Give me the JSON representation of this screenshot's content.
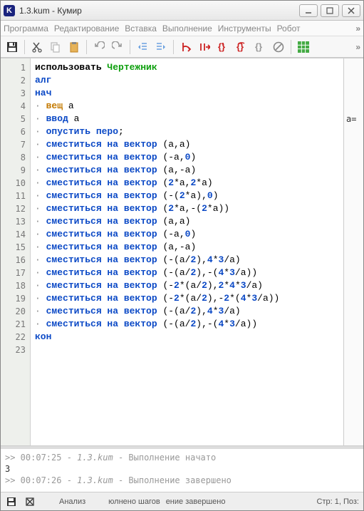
{
  "window": {
    "title": "1.3.kum - Кумир"
  },
  "menu": {
    "program": "Программа",
    "edit": "Редактирование",
    "insert": "Вставка",
    "run": "Выполнение",
    "tools": "Инструменты",
    "robot": "Робот"
  },
  "code": {
    "lines": [
      {
        "n": 1,
        "indent": 0,
        "dot": false,
        "tokens": [
          [
            "use",
            "использовать "
          ],
          [
            "mod",
            "Чертежник"
          ]
        ]
      },
      {
        "n": 2,
        "indent": 0,
        "dot": false,
        "tokens": [
          [
            "kw",
            "алг"
          ]
        ]
      },
      {
        "n": 3,
        "indent": 0,
        "dot": false,
        "tokens": [
          [
            "kw",
            "нач"
          ]
        ]
      },
      {
        "n": 4,
        "indent": 1,
        "dot": true,
        "tokens": [
          [
            "type",
            "вещ"
          ],
          [
            "",
            " a"
          ]
        ]
      },
      {
        "n": 5,
        "indent": 1,
        "dot": true,
        "tokens": [
          [
            "kw",
            "ввод"
          ],
          [
            "",
            " a"
          ]
        ]
      },
      {
        "n": 6,
        "indent": 1,
        "dot": true,
        "tokens": [
          [
            "kw",
            "опустить перо"
          ],
          [
            "",
            ";"
          ]
        ]
      },
      {
        "n": 7,
        "indent": 1,
        "dot": true,
        "tokens": [
          [
            "kw",
            "сместиться на вектор"
          ],
          [
            "",
            " (a,a)"
          ]
        ]
      },
      {
        "n": 8,
        "indent": 1,
        "dot": true,
        "tokens": [
          [
            "kw",
            "сместиться на вектор"
          ],
          [
            "",
            " (-a,"
          ],
          [
            "num",
            "0"
          ],
          [
            "",
            ")"
          ]
        ]
      },
      {
        "n": 9,
        "indent": 1,
        "dot": true,
        "tokens": [
          [
            "kw",
            "сместиться на вектор"
          ],
          [
            "",
            " (a,-a)"
          ]
        ]
      },
      {
        "n": 10,
        "indent": 1,
        "dot": true,
        "tokens": [
          [
            "kw",
            "сместиться на вектор"
          ],
          [
            "",
            " ("
          ],
          [
            "num",
            "2"
          ],
          [
            "",
            "*a,"
          ],
          [
            "num",
            "2"
          ],
          [
            "",
            "*a)"
          ]
        ]
      },
      {
        "n": 11,
        "indent": 1,
        "dot": true,
        "tokens": [
          [
            "kw",
            "сместиться на вектор"
          ],
          [
            "",
            " (-("
          ],
          [
            "num",
            "2"
          ],
          [
            "",
            "*a),"
          ],
          [
            "num",
            "0"
          ],
          [
            "",
            ")"
          ]
        ]
      },
      {
        "n": 12,
        "indent": 1,
        "dot": true,
        "tokens": [
          [
            "kw",
            "сместиться на вектор"
          ],
          [
            "",
            " ("
          ],
          [
            "num",
            "2"
          ],
          [
            "",
            "*a,-("
          ],
          [
            "num",
            "2"
          ],
          [
            "",
            "*a))"
          ]
        ]
      },
      {
        "n": 13,
        "indent": 1,
        "dot": true,
        "tokens": [
          [
            "kw",
            "сместиться на вектор"
          ],
          [
            "",
            " (a,a)"
          ]
        ]
      },
      {
        "n": 14,
        "indent": 1,
        "dot": true,
        "tokens": [
          [
            "kw",
            "сместиться на вектор"
          ],
          [
            "",
            " (-a,"
          ],
          [
            "num",
            "0"
          ],
          [
            "",
            ")"
          ]
        ]
      },
      {
        "n": 15,
        "indent": 1,
        "dot": true,
        "tokens": [
          [
            "kw",
            "сместиться на вектор"
          ],
          [
            "",
            " (a,-a)"
          ]
        ]
      },
      {
        "n": 16,
        "indent": 1,
        "dot": true,
        "tokens": [
          [
            "kw",
            "сместиться на вектор"
          ],
          [
            "",
            " (-(a/"
          ],
          [
            "num",
            "2"
          ],
          [
            "",
            "),"
          ],
          [
            "num",
            "4"
          ],
          [
            "",
            "*"
          ],
          [
            "num",
            "3"
          ],
          [
            "",
            "/a)"
          ]
        ]
      },
      {
        "n": 17,
        "indent": 1,
        "dot": true,
        "tokens": [
          [
            "kw",
            "сместиться на вектор"
          ],
          [
            "",
            " (-(a/"
          ],
          [
            "num",
            "2"
          ],
          [
            "",
            "),-("
          ],
          [
            "num",
            "4"
          ],
          [
            "",
            "*"
          ],
          [
            "num",
            "3"
          ],
          [
            "",
            "/a))"
          ]
        ]
      },
      {
        "n": 18,
        "indent": 1,
        "dot": true,
        "tokens": [
          [
            "kw",
            "сместиться на вектор"
          ],
          [
            "",
            " (-"
          ],
          [
            "num",
            "2"
          ],
          [
            "",
            "*(a/"
          ],
          [
            "num",
            "2"
          ],
          [
            "",
            "),"
          ],
          [
            "num",
            "2"
          ],
          [
            "",
            "*"
          ],
          [
            "num",
            "4"
          ],
          [
            "",
            "*"
          ],
          [
            "num",
            "3"
          ],
          [
            "",
            "/a)"
          ]
        ]
      },
      {
        "n": 19,
        "indent": 1,
        "dot": true,
        "tokens": [
          [
            "kw",
            "сместиться на вектор"
          ],
          [
            "",
            " (-"
          ],
          [
            "num",
            "2"
          ],
          [
            "",
            "*(a/"
          ],
          [
            "num",
            "2"
          ],
          [
            "",
            "),-"
          ],
          [
            "num",
            "2"
          ],
          [
            "",
            "*("
          ],
          [
            "num",
            "4"
          ],
          [
            "",
            "*"
          ],
          [
            "num",
            "3"
          ],
          [
            "",
            "/a))"
          ]
        ]
      },
      {
        "n": 20,
        "indent": 1,
        "dot": true,
        "tokens": [
          [
            "kw",
            "сместиться на вектор"
          ],
          [
            "",
            " (-(a/"
          ],
          [
            "num",
            "2"
          ],
          [
            "",
            "),"
          ],
          [
            "num",
            "4"
          ],
          [
            "",
            "*"
          ],
          [
            "num",
            "3"
          ],
          [
            "",
            "/a)"
          ]
        ]
      },
      {
        "n": 21,
        "indent": 1,
        "dot": true,
        "tokens": [
          [
            "kw",
            "сместиться на вектор"
          ],
          [
            "",
            " (-(a/"
          ],
          [
            "num",
            "2"
          ],
          [
            "",
            "),-("
          ],
          [
            "num",
            "4"
          ],
          [
            "",
            "*"
          ],
          [
            "num",
            "3"
          ],
          [
            "",
            "/a))"
          ]
        ]
      },
      {
        "n": 22,
        "indent": 0,
        "dot": false,
        "tokens": [
          [
            "kw",
            "кон"
          ]
        ]
      },
      {
        "n": 23,
        "indent": 0,
        "dot": false,
        "tokens": []
      }
    ]
  },
  "side": {
    "var": "a="
  },
  "console": {
    "line1_prefix": ">> 00:07:25 - ",
    "line1_file": "1.3.kum",
    "line1_suffix": " - Выполнение начато",
    "line2": "3",
    "line3_prefix": ">> 00:07:26 - ",
    "line3_file": "1.3.kum",
    "line3_suffix": " - Выполнение завершено"
  },
  "status": {
    "analysis": "Анализ",
    "steps": "юлнено шагов",
    "done": "ение завершено",
    "pos": "Стр: 1, Поз:"
  }
}
